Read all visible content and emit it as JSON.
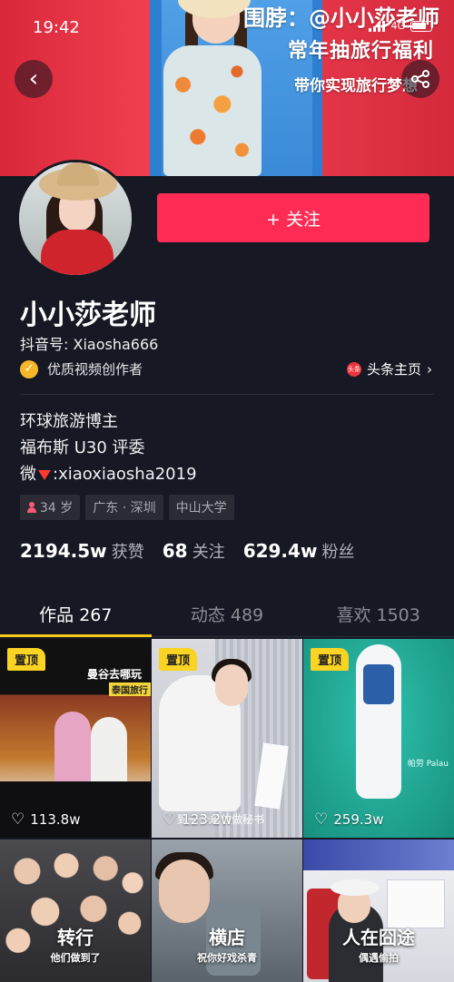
{
  "status_bar": {
    "time": "19:42",
    "network": "4G"
  },
  "banner": {
    "line1": "围脖：@小小莎老师",
    "line2": "常年抽旅行福利",
    "line3": "带你实现旅行梦想"
  },
  "profile": {
    "follow_label": "+ 关注",
    "name": "小小莎老师",
    "douyin_id": "抖音号: Xiaosha666",
    "verified_label": "优质视频创作者",
    "toutiao_icon_text": "头条",
    "toutiao_label": "头条主页",
    "bio": {
      "line1": "环球旅游博主",
      "line2": "福布斯 U30 评委",
      "line3_prefix": "微",
      "line3_suffix": ":xiaoxiaosha2019"
    },
    "tags": {
      "age": "34 岁",
      "location": "广东 · 深圳",
      "school": "中山大学"
    },
    "stats": {
      "likes_count": "2194.5w",
      "likes_label": "获赞",
      "following_count": "68",
      "following_label": "关注",
      "fans_count": "629.4w",
      "fans_label": "粉丝"
    }
  },
  "tabs": [
    {
      "label": "作品 267"
    },
    {
      "label": "动态 489"
    },
    {
      "label": "喜欢 1503"
    }
  ],
  "videos": [
    {
      "pinned_label": "置顶",
      "likes": "113.8w",
      "caption": "曼谷去哪玩",
      "caption2": "泰国旅行"
    },
    {
      "pinned_label": "置顶",
      "likes": "123.2w",
      "caption": "到一个单位做秘书"
    },
    {
      "pinned_label": "置顶",
      "likes": "259.3w",
      "caption": "帕劳 Palau"
    },
    {
      "caption": "转行",
      "caption2": "他们做到了"
    },
    {
      "caption": "横店",
      "caption2": "祝你好戏杀青"
    },
    {
      "caption": "人在囧途",
      "caption2": "偶遇偷拍"
    }
  ],
  "colors": {
    "background": "#161823",
    "follow_button": "#fe2c55",
    "tab_indicator": "#facc15",
    "pinned_badge": "#fbd322"
  }
}
